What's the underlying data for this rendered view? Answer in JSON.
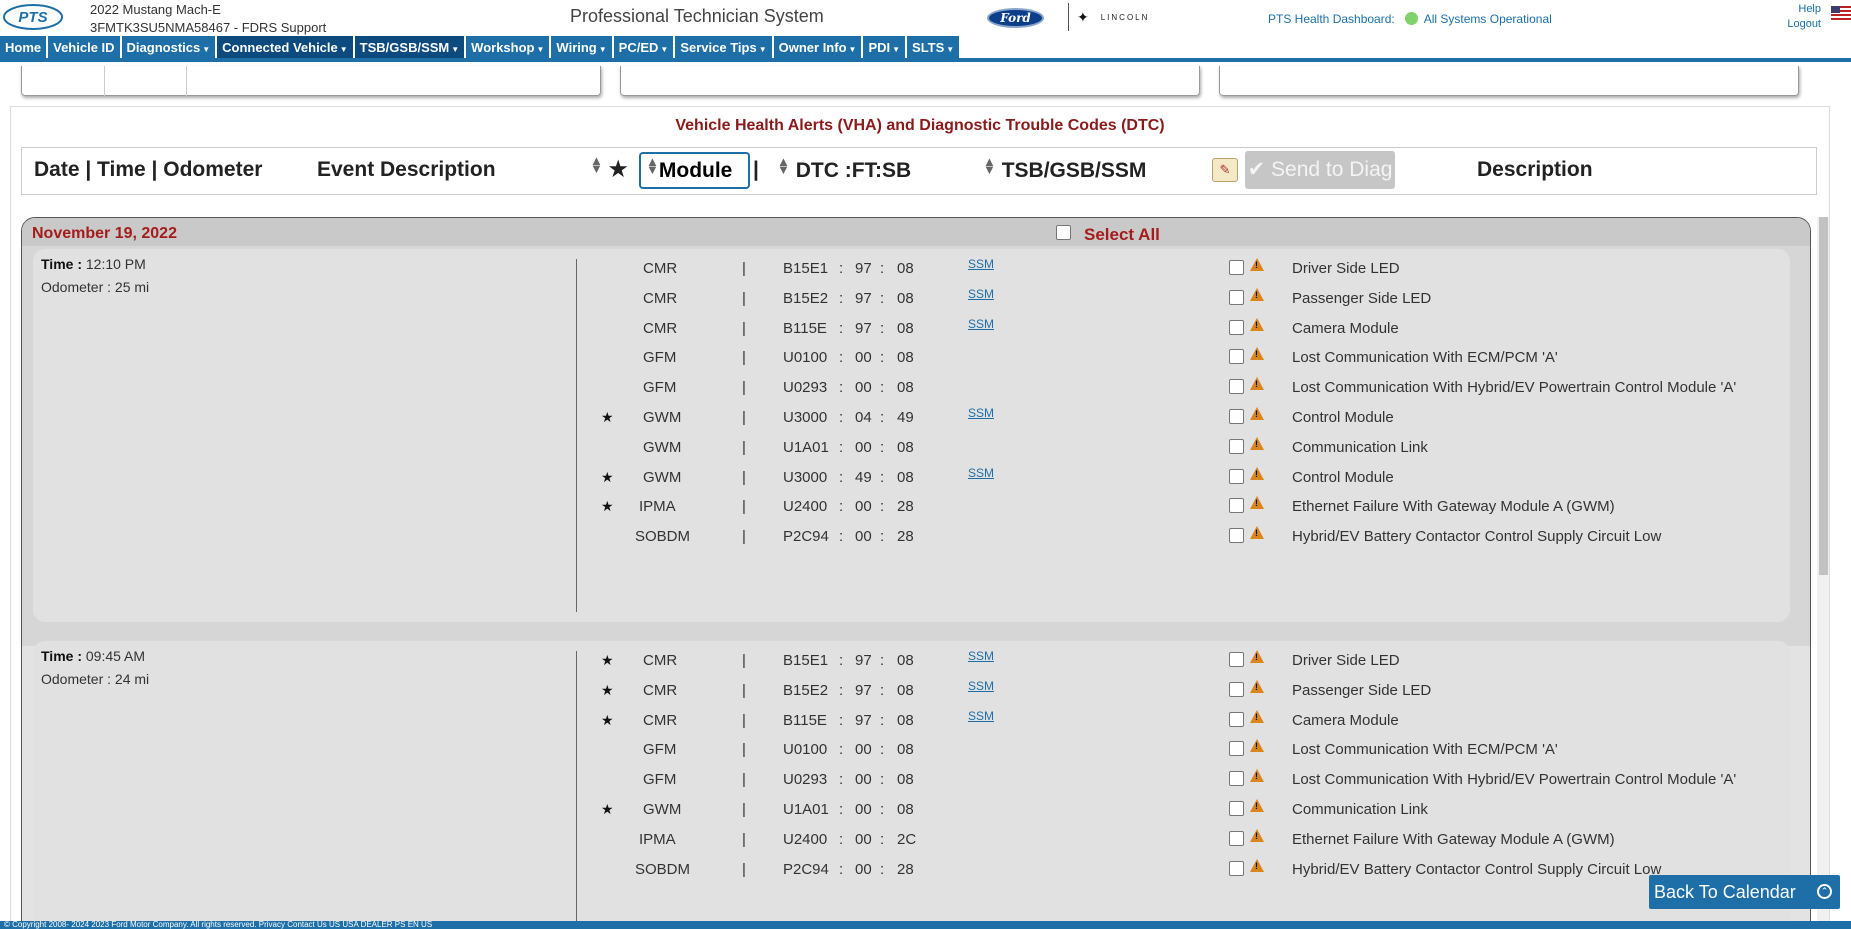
{
  "header": {
    "vehicle_model": "2022 Mustang Mach-E",
    "vin_line": "3FMTK3SU5NMA58467 - FDRS Support",
    "app_title": "Professional Technician System",
    "ford_logo": "Ford",
    "lincoln_logo": "LINCOLN",
    "health_label": "PTS Health Dashboard:",
    "health_status": "All Systems Operational",
    "help": "Help",
    "logout": "Logout"
  },
  "nav": [
    "Home",
    "Vehicle ID",
    "Diagnostics",
    "Connected Vehicle",
    "TSB/GSB/SSM",
    "Workshop",
    "Wiring",
    "PC/ED",
    "Service Tips",
    "Owner Info",
    "PDI",
    "SLTS"
  ],
  "table": {
    "title": "Vehicle Health Alerts (VHA) and Diagnostic Trouble Codes (DTC)",
    "col_date": "Date | Time | Odometer",
    "col_event": "Event Description",
    "col_module": "Module",
    "col_dtc": "DTC  :FT:SB",
    "col_tsb": "TSB/GSB/SSM",
    "send_btn": "Send to Diag",
    "col_desc": "Description",
    "select_all": "Select All"
  },
  "date": "November 19, 2022",
  "groups": [
    {
      "time_label": "Time :",
      "time": "12:10 PM",
      "odometer": "Odometer : 25 mi",
      "rows": [
        {
          "star": false,
          "module": "CMR",
          "dtc": "B15E1",
          "ft": "97",
          "sb": "08",
          "ssm": "SSM",
          "desc": "Driver Side LED"
        },
        {
          "star": false,
          "module": "CMR",
          "dtc": "B15E2",
          "ft": "97",
          "sb": "08",
          "ssm": "SSM",
          "desc": "Passenger Side LED"
        },
        {
          "star": false,
          "module": "CMR",
          "dtc": "B115E",
          "ft": "97",
          "sb": "08",
          "ssm": "SSM",
          "desc": "Camera Module"
        },
        {
          "star": false,
          "module": "GFM",
          "dtc": "U0100",
          "ft": "00",
          "sb": "08",
          "ssm": "",
          "desc": "Lost Communication With ECM/PCM 'A'"
        },
        {
          "star": false,
          "module": "GFM",
          "dtc": "U0293",
          "ft": "00",
          "sb": "08",
          "ssm": "",
          "desc": "Lost Communication With Hybrid/EV Powertrain Control Module 'A'"
        },
        {
          "star": true,
          "module": "GWM",
          "dtc": "U3000",
          "ft": "04",
          "sb": "49",
          "ssm": "SSM",
          "desc": "Control Module"
        },
        {
          "star": false,
          "module": "GWM",
          "dtc": "U1A01",
          "ft": "00",
          "sb": "08",
          "ssm": "",
          "desc": "Communication Link"
        },
        {
          "star": true,
          "module": "GWM",
          "dtc": "U3000",
          "ft": "49",
          "sb": "08",
          "ssm": "SSM",
          "desc": "Control Module"
        },
        {
          "star": true,
          "module": "IPMA",
          "dtc": "U2400",
          "ft": "00",
          "sb": "28",
          "ssm": "",
          "desc": "Ethernet Failure With Gateway Module A (GWM)"
        },
        {
          "star": false,
          "module": "SOBDM",
          "dtc": "P2C94",
          "ft": "00",
          "sb": "28",
          "ssm": "",
          "desc": "Hybrid/EV Battery Contactor Control Supply Circuit Low"
        }
      ]
    },
    {
      "time_label": "Time :",
      "time": "09:45 AM",
      "odometer": "Odometer : 24 mi",
      "rows": [
        {
          "star": true,
          "module": "CMR",
          "dtc": "B15E1",
          "ft": "97",
          "sb": "08",
          "ssm": "SSM",
          "desc": "Driver Side LED"
        },
        {
          "star": true,
          "module": "CMR",
          "dtc": "B15E2",
          "ft": "97",
          "sb": "08",
          "ssm": "SSM",
          "desc": "Passenger Side LED"
        },
        {
          "star": true,
          "module": "CMR",
          "dtc": "B115E",
          "ft": "97",
          "sb": "08",
          "ssm": "SSM",
          "desc": "Camera Module"
        },
        {
          "star": false,
          "module": "GFM",
          "dtc": "U0100",
          "ft": "00",
          "sb": "08",
          "ssm": "",
          "desc": "Lost Communication With ECM/PCM 'A'"
        },
        {
          "star": false,
          "module": "GFM",
          "dtc": "U0293",
          "ft": "00",
          "sb": "08",
          "ssm": "",
          "desc": "Lost Communication With Hybrid/EV Powertrain Control Module 'A'"
        },
        {
          "star": true,
          "module": "GWM",
          "dtc": "U1A01",
          "ft": "00",
          "sb": "08",
          "ssm": "",
          "desc": "Communication Link"
        },
        {
          "star": false,
          "module": "IPMA",
          "dtc": "U2400",
          "ft": "00",
          "sb": "2C",
          "ssm": "",
          "desc": "Ethernet Failure With Gateway Module A (GWM)"
        },
        {
          "star": false,
          "module": "SOBDM",
          "dtc": "P2C94",
          "ft": "00",
          "sb": "28",
          "ssm": "",
          "desc": "Hybrid/EV Battery Contactor Control Supply Circuit Low"
        }
      ]
    }
  ],
  "back_to_calendar": "Back To Calendar",
  "footer": "© Copyright 2008- 2024 2023 Ford Motor Company. All rights reserved. Privacy Contact Us US USA DEALER PS EN US"
}
